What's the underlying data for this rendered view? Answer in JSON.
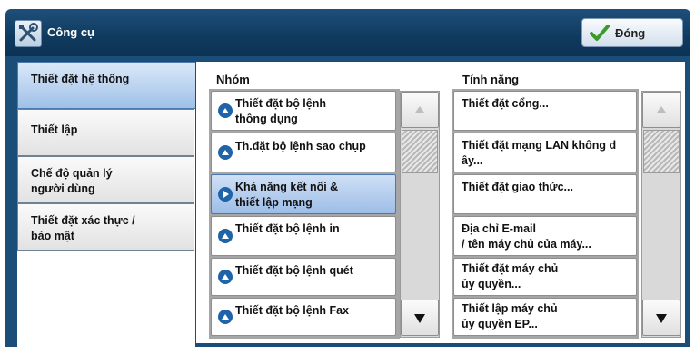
{
  "window": {
    "title": "Công cụ",
    "close_label": "Đóng"
  },
  "tabs": [
    {
      "label": "Thiết đặt hệ thống",
      "active": true
    },
    {
      "label": "Thiết lập",
      "active": false
    },
    {
      "label": "Chế độ quản lý\nngười dùng",
      "active": false
    },
    {
      "label": "Thiết đặt xác thực /\nbảo mật",
      "active": false
    }
  ],
  "groups": {
    "header": "Nhóm",
    "items": [
      {
        "label": "Thiết đặt bộ lệnh\nthông dụng",
        "icon": "up-circle-icon",
        "selected": false
      },
      {
        "label": "Th.đặt bộ lệnh sao chụp",
        "icon": "up-circle-icon",
        "selected": false
      },
      {
        "label": "Khả năng kết nối &\nthiết lập mạng",
        "icon": "right-circle-icon",
        "selected": true
      },
      {
        "label": "Thiết đặt bộ lệnh in",
        "icon": "up-circle-icon",
        "selected": false
      },
      {
        "label": "Thiết đặt bộ lệnh quét",
        "icon": "up-circle-icon",
        "selected": false
      },
      {
        "label": "Thiết đặt bộ lệnh Fax",
        "icon": "up-circle-icon",
        "selected": false
      }
    ]
  },
  "features": {
    "header": "Tính năng",
    "items": [
      {
        "label": "Thiết đặt cổng..."
      },
      {
        "label": "Thiết đặt mạng LAN không d\nây..."
      },
      {
        "label": "Thiết đặt giao thức..."
      },
      {
        "label": "Địa chỉ E-mail\n/ tên máy chủ của máy..."
      },
      {
        "label": "Thiết đặt máy chủ\nủy quyền..."
      },
      {
        "label": "Thiết lập máy chủ\nủy quyền EP..."
      }
    ]
  },
  "colors": {
    "accent": "#1a4d78",
    "selected": "#9dbde6"
  }
}
